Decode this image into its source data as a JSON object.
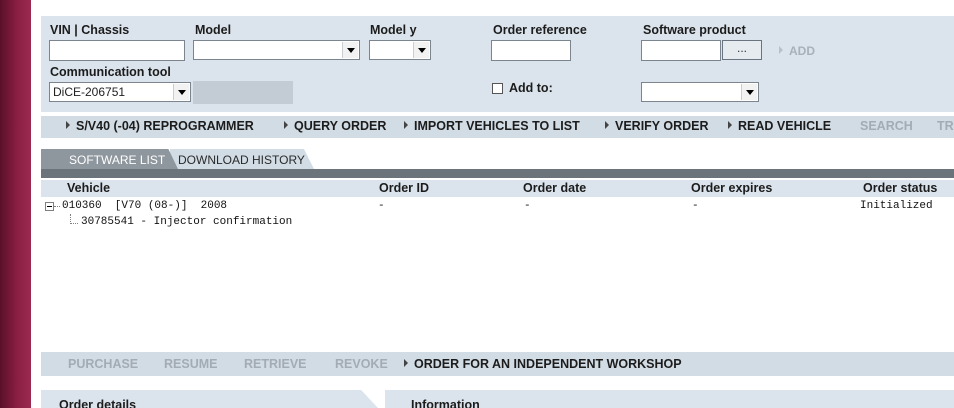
{
  "form": {
    "vin_label": "VIN | Chassis",
    "vin_value": "",
    "model_label": "Model",
    "model_value": "",
    "model_year_label": "Model y",
    "model_year_value": "",
    "order_ref_label": "Order reference",
    "order_ref_value": "",
    "software_product_label": "Software product",
    "software_product_value": "",
    "browse_label": "...",
    "add_label": "ADD",
    "comm_tool_label": "Communication tool",
    "comm_tool_value": "DiCE-206751",
    "add_to_label": "Add to:",
    "add_to_value": ""
  },
  "actions": [
    {
      "label": "S/V40 (-04) REPROGRAMMER",
      "enabled": true
    },
    {
      "label": "QUERY ORDER",
      "enabled": true
    },
    {
      "label": "IMPORT VEHICLES TO LIST",
      "enabled": true
    },
    {
      "label": "VERIFY ORDER",
      "enabled": true
    },
    {
      "label": "READ VEHICLE",
      "enabled": true
    },
    {
      "label": "SEARCH",
      "enabled": false
    },
    {
      "label": "TR",
      "enabled": false
    }
  ],
  "tabs": [
    {
      "label": "SOFTWARE LIST",
      "active": true
    },
    {
      "label": "DOWNLOAD HISTORY",
      "active": false
    }
  ],
  "table": {
    "columns": [
      "Vehicle",
      "Order ID",
      "Order date",
      "Order expires",
      "Order status"
    ],
    "rows": [
      {
        "vehicle": "010360  [V70 (08-)]  2008",
        "order_id": "-",
        "order_date": "-",
        "order_expires": "-",
        "order_status": "Initialized"
      }
    ],
    "child": "30785541 - Injector confirmation"
  },
  "bottom_actions": [
    {
      "label": "PURCHASE",
      "enabled": false
    },
    {
      "label": "RESUME",
      "enabled": false
    },
    {
      "label": "RETRIEVE",
      "enabled": false
    },
    {
      "label": "REVOKE",
      "enabled": false
    },
    {
      "label": "ORDER FOR AN INDEPENDENT WORKSHOP",
      "enabled": true
    }
  ],
  "panels": {
    "order_details": "Order details",
    "information": "Information"
  },
  "colors": {
    "brand_bar": "#8a1e43",
    "panel_bg": "#dbe4ec",
    "action_bar_bg": "#d2dce5",
    "active_tab": "#8e969e"
  },
  "icons": {
    "action_arrow": "triangle-right-icon",
    "tree_toggle": "tree-collapse-icon",
    "dropdown": "chevron-down-icon"
  }
}
